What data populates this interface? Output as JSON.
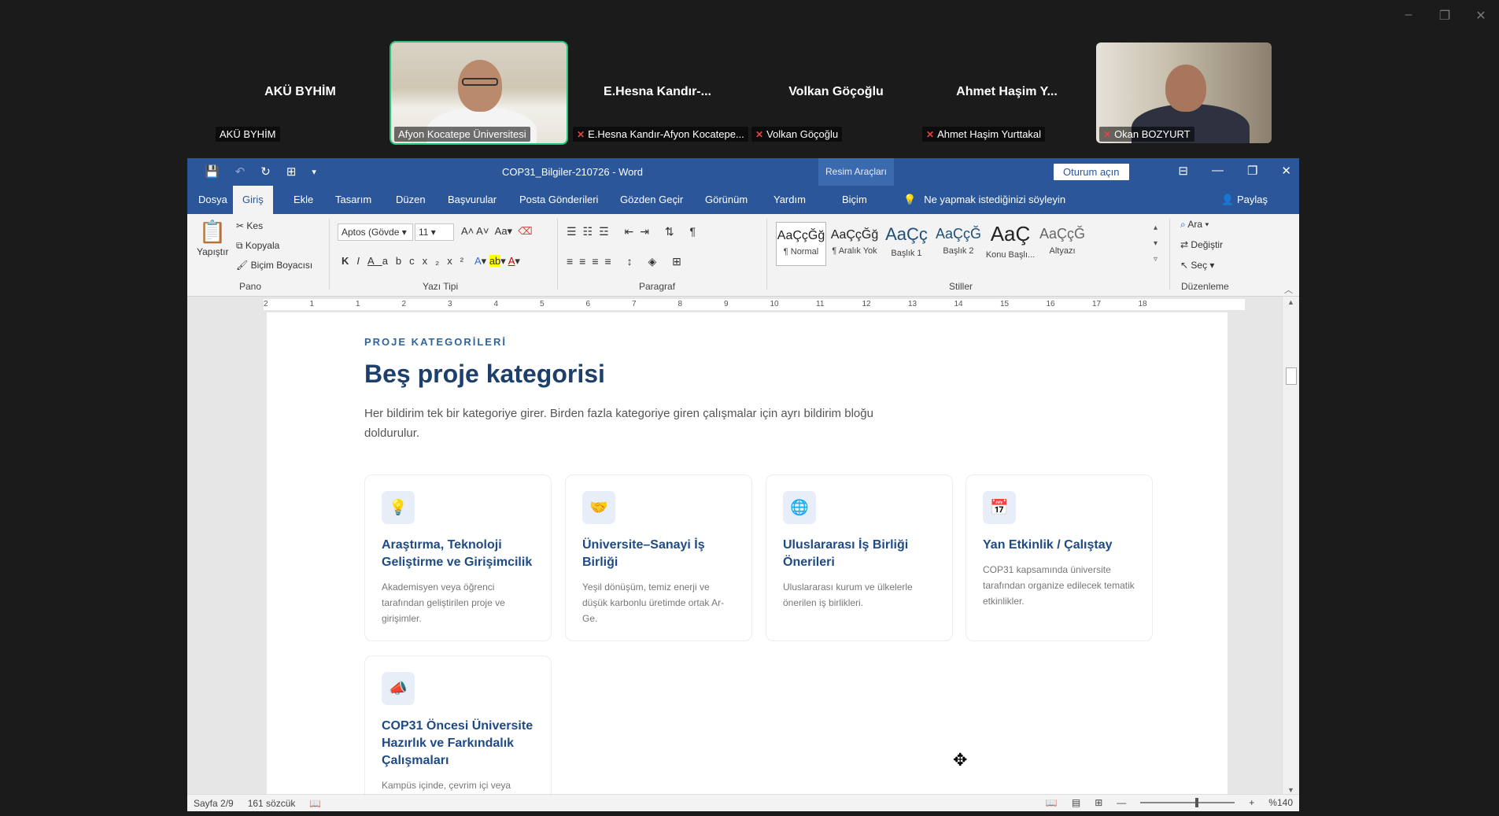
{
  "window_controls": [
    "–",
    "❐",
    "✕"
  ],
  "participants": [
    {
      "name_center": "AKÜ BYHİM",
      "label": "AKÜ BYHİM",
      "muted": false,
      "video": false
    },
    {
      "name_center": "",
      "label": "Afyon Kocatepe Üniversitesi",
      "muted": false,
      "video": true,
      "active": true
    },
    {
      "name_center": "E.Hesna  Kandır-...",
      "label": "E.Hesna Kandır-Afyon Kocatepe...",
      "muted": true,
      "video": false
    },
    {
      "name_center": "Volkan Göçoğlu",
      "label": "Volkan Göçoğlu",
      "muted": true,
      "video": false
    },
    {
      "name_center": "Ahmet Haşim Y...",
      "label": "Ahmet Haşim Yurttakal",
      "muted": true,
      "video": false
    },
    {
      "name_center": "",
      "label": "Okan BOZYURT",
      "muted": true,
      "video": true
    }
  ],
  "word": {
    "title": "COP31_Bilgiler-210726  -  Word",
    "context_tools": "Resim Araçları",
    "signin": "Oturum açın",
    "tabs": [
      "Dosya",
      "Giriş",
      "Ekle",
      "Tasarım",
      "Düzen",
      "Başvurular",
      "Posta Gönderileri",
      "Gözden Geçir",
      "Görünüm",
      "Yardım",
      "Biçim"
    ],
    "tellme": "Ne yapmak istediğinizi söyleyin",
    "share": "Paylaş",
    "ribbon": {
      "pano": {
        "paste": "Yapıştır",
        "cut": "Kes",
        "copy": "Kopyala",
        "format_painter": "Biçim Boyacısı",
        "label": "Pano"
      },
      "font": {
        "name": "Aptos (Gövde",
        "size": "11",
        "label": "Yazı Tipi"
      },
      "paragraph": {
        "label": "Paragraf"
      },
      "styles": {
        "label": "Stiller",
        "items": [
          {
            "sample": "AaÇçĞğ",
            "name": "¶ Normal"
          },
          {
            "sample": "AaÇçĞğ",
            "name": "¶ Aralık Yok"
          },
          {
            "sample": "AaÇç",
            "name": "Başlık 1"
          },
          {
            "sample": "AaÇçĞ",
            "name": "Başlık 2"
          },
          {
            "sample": "AaÇ",
            "name": "Konu Başlı..."
          },
          {
            "sample": "AaÇçĞ",
            "name": "Altyazı"
          }
        ]
      },
      "editing": {
        "find": "Ara",
        "replace": "Değiştir",
        "select": "Seç",
        "label": "Düzenleme"
      }
    },
    "ruler_numbers": [
      "2",
      "1",
      "1",
      "2",
      "3",
      "4",
      "5",
      "6",
      "7",
      "8",
      "9",
      "10",
      "11",
      "12",
      "13",
      "14",
      "15",
      "16",
      "17",
      "18"
    ],
    "document": {
      "eyebrow": "PROJE KATEGORİLERİ",
      "heading": "Beş proje kategorisi",
      "lead": "Her bildirim tek bir kategoriye girer. Birden fazla kategoriye giren çalışmalar için ayrı bildirim bloğu doldurulur.",
      "cards": [
        {
          "icon": "lightbulb-icon",
          "glyph": "💡",
          "title": "Araştırma, Teknoloji Geliştirme ve Girişimcilik",
          "desc": "Akademisyen veya öğrenci tarafından geliştirilen proje ve girişimler."
        },
        {
          "icon": "handshake-icon",
          "glyph": "🤝",
          "title": "Üniversite–Sanayi İş Birliği",
          "desc": "Yeşil dönüşüm, temiz enerji ve düşük karbonlu üretimde ortak Ar-Ge."
        },
        {
          "icon": "globe-icon",
          "glyph": "🌐",
          "title": "Uluslararası İş Birliği Önerileri",
          "desc": "Uluslararası kurum ve ülkelerle önerilen iş birlikleri."
        },
        {
          "icon": "calendar-icon",
          "glyph": "📅",
          "title": "Yan Etkinlik / Çalıştay",
          "desc": "COP31 kapsamında üniversite tarafından organize edilecek tematik etkinlikler."
        },
        {
          "icon": "megaphone-icon",
          "glyph": "📣",
          "title": "COP31 Öncesi Üniversite Hazırlık ve Farkındalık Çalışmaları",
          "desc": "Kampüs içinde, çevrim içi veya"
        }
      ]
    },
    "status": {
      "page": "Sayfa 2/9",
      "words": "161 sözcük",
      "zoom": "%140"
    }
  }
}
